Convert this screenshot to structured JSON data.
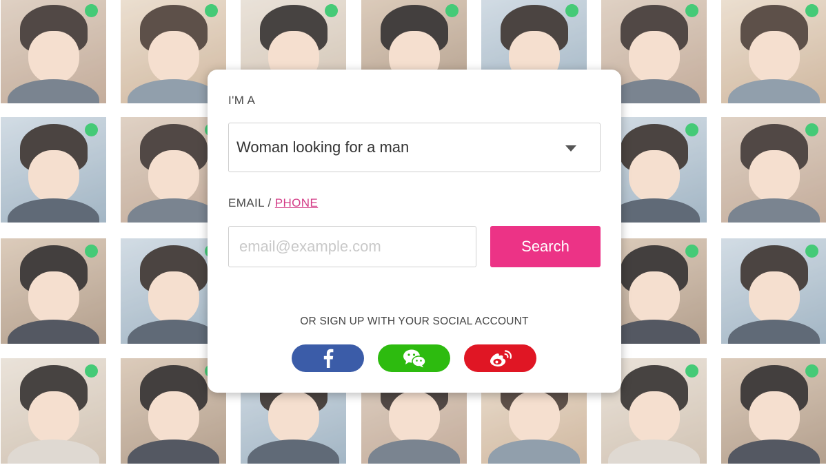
{
  "form": {
    "im_a_label": "I'M A",
    "seeking_selected": "Woman looking for a man",
    "email_label": "EMAIL / ",
    "phone_link": "PHONE",
    "email_placeholder": "email@example.com",
    "search_button": "Search",
    "social_label": "OR SIGN UP WITH YOUR SOCIAL ACCOUNT"
  },
  "social": [
    {
      "name": "facebook",
      "icon": "facebook-icon",
      "color": "#3b5ca8"
    },
    {
      "name": "wechat",
      "icon": "wechat-icon",
      "color": "#2dbb0f"
    },
    {
      "name": "weibo",
      "icon": "weibo-icon",
      "color": "#e01624"
    }
  ],
  "colors": {
    "accent": "#ec3386",
    "link": "#d33b86",
    "online": "#1dbf5a"
  },
  "profiles": [
    {
      "online": true
    },
    {
      "online": true
    },
    {
      "online": true
    },
    {
      "online": true
    },
    {
      "online": true
    },
    {
      "online": true
    },
    {
      "online": true
    },
    {
      "online": true
    },
    {
      "online": true
    },
    {
      "online": false
    },
    {
      "online": false
    },
    {
      "online": false
    },
    {
      "online": true
    },
    {
      "online": true
    },
    {
      "online": true
    },
    {
      "online": true
    },
    {
      "online": false
    },
    {
      "online": false
    },
    {
      "online": false
    },
    {
      "online": true
    },
    {
      "online": true
    },
    {
      "online": true
    },
    {
      "online": true
    },
    {
      "online": false
    },
    {
      "online": false
    },
    {
      "online": false
    },
    {
      "online": true
    },
    {
      "online": true
    }
  ]
}
